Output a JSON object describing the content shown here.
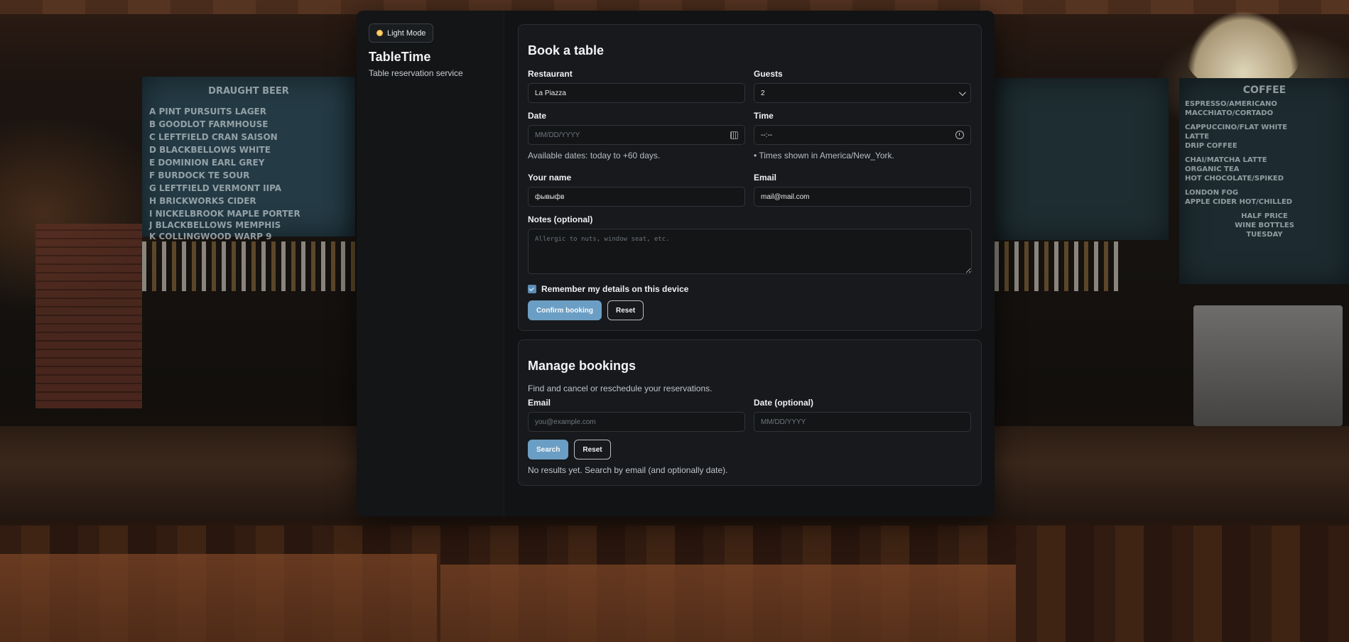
{
  "sidebar": {
    "mode_button": "Light Mode",
    "brand": "TableTime",
    "tagline": "Table reservation service"
  },
  "book": {
    "title": "Book a table",
    "restaurant_label": "Restaurant",
    "restaurant_value": "La Piazza",
    "guests_label": "Guests",
    "guests_value": "2",
    "date_label": "Date",
    "date_placeholder": "MM/DD/YYYY",
    "date_hint": "Available dates: today to +60 days.",
    "time_label": "Time",
    "time_placeholder": "--:--",
    "time_hint": "• Times shown in America/New_York.",
    "name_label": "Your name",
    "name_value": "фывыфв",
    "email_label": "Email",
    "email_value": "mail@mail.com",
    "notes_label": "Notes (optional)",
    "notes_placeholder": "Allergic to nuts, window seat, etc.",
    "remember_label": "Remember my details on this device",
    "remember_checked": true,
    "confirm_button": "Confirm booking",
    "reset_button": "Reset"
  },
  "manage": {
    "title": "Manage bookings",
    "subtitle": "Find and cancel or reschedule your reservations.",
    "email_label": "Email",
    "email_placeholder": "you@example.com",
    "date_label": "Date (optional)",
    "date_placeholder": "MM/DD/YYYY",
    "search_button": "Search",
    "reset_button": "Reset",
    "no_results": "No results yet. Search by email (and optionally date)."
  },
  "background": {
    "left_board": [
      "DRAUGHT BEER",
      "A PINT PURSUITS LAGER",
      "B GOODLOT FARMHOUSE",
      "C LEFTFIELD CRAN SAISON",
      "D BLACKBELLOWS WHITE",
      "E DOMINION EARL GREY",
      "F BURDOCK TE SOUR",
      "G LEFTFIELD VERMONT IIPA",
      "H BRICKWORKS CIDER",
      "I NICKELBROOK MAPLE PORTER",
      "J BLACKBELLOWS MEMPHIS",
      "K COLLINGWOOD WARP 9"
    ],
    "right_board": [
      "COFFEE",
      "ESPRESSO/AMERICANO",
      "MACCHIATO/CORTADO",
      "CAPPUCCINO/FLAT WHITE",
      "LATTE",
      "DRIP COFFEE",
      "CHAI/MATCHA LATTE",
      "ORGANIC TEA",
      "HOT CHOCOLATE/SPIKED",
      "LONDON FOG",
      "APPLE CIDER HOT/CHILLED",
      "HALF PRICE",
      "WINE BOTTLES",
      "TUESDAY"
    ]
  },
  "colors": {
    "accent": "#6b9ec4",
    "panel": "#111315",
    "card": "#17191c"
  }
}
